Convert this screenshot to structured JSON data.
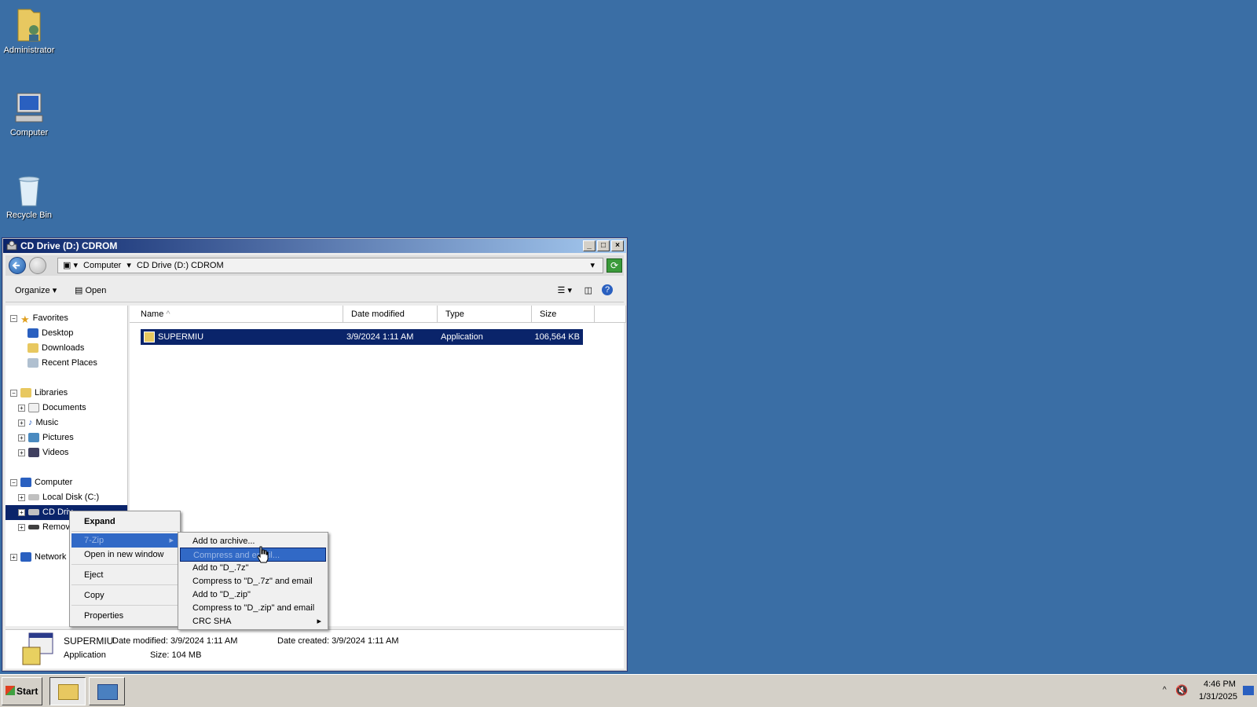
{
  "desktop": {
    "icons": [
      {
        "label": "Administrator"
      },
      {
        "label": "Computer"
      },
      {
        "label": "Recycle Bin"
      }
    ]
  },
  "window": {
    "title": "CD Drive (D:) CDROM",
    "address": [
      "Computer",
      "CD Drive (D:) CDROM"
    ],
    "toolbar": {
      "organize": "Organize",
      "open": "Open"
    },
    "nav": {
      "favorites": "Favorites",
      "fav_items": [
        "Desktop",
        "Downloads",
        "Recent Places"
      ],
      "libraries": "Libraries",
      "lib_items": [
        "Documents",
        "Music",
        "Pictures",
        "Videos"
      ],
      "computer": "Computer",
      "comp_items": [
        "Local Disk (C:)",
        "CD Driv",
        "Remov"
      ],
      "network": "Network"
    },
    "columns": [
      "Name",
      "Date modified",
      "Type",
      "Size"
    ],
    "files": [
      {
        "name": "SUPERMIU",
        "date": "3/9/2024 1:11 AM",
        "type": "Application",
        "size": "106,564 KB"
      }
    ],
    "details": {
      "name": "SUPERMIU",
      "type": "Application",
      "date_modified": "Date modified: 3/9/2024 1:11 AM",
      "date_created": "Date created: 3/9/2024 1:11 AM",
      "size": "Size:  104 MB"
    }
  },
  "context_menu": {
    "items": [
      "Expand",
      "7-Zip",
      "Open in new window",
      "Eject",
      "Copy",
      "Properties"
    ]
  },
  "submenu": {
    "items": [
      "Add to archive...",
      "Compress and email...",
      "Add to \"D_.7z\"",
      "Compress to \"D_.7z\" and email",
      "Add to \"D_.zip\"",
      "Compress to \"D_.zip\" and email",
      "CRC SHA"
    ]
  },
  "taskbar": {
    "start": "Start",
    "time": "4:46 PM",
    "date": "1/31/2025"
  },
  "colors": {
    "desktop": "#3a6ea5",
    "selection": "#0a246a",
    "menu_highlight": "#3399ff"
  }
}
